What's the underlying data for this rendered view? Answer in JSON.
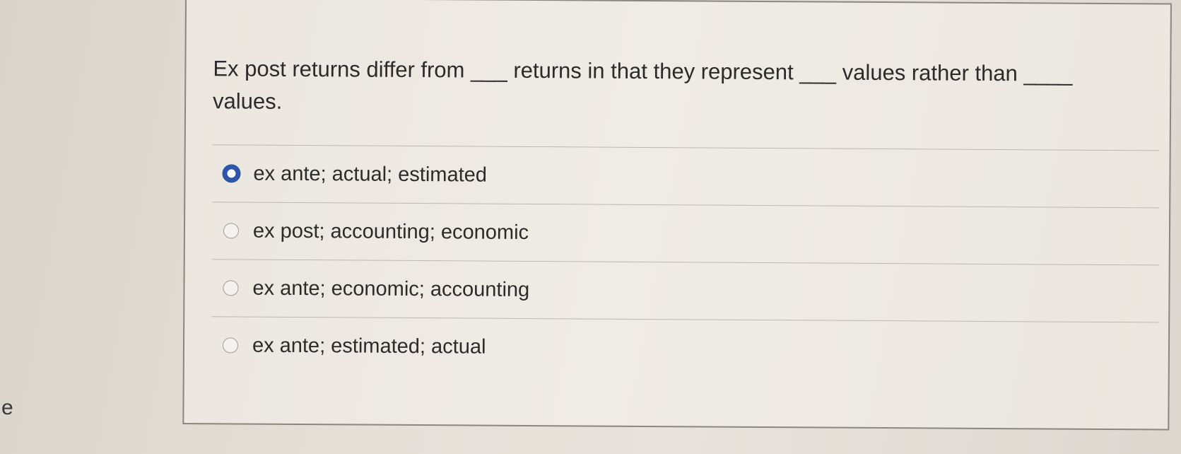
{
  "side_text": "e",
  "question": {
    "text": "Ex post returns differ from ___ returns in that they represent ___ values rather than ____ values."
  },
  "options": [
    {
      "label": "ex ante; actual; estimated",
      "selected": true
    },
    {
      "label": "ex post; accounting; economic",
      "selected": false
    },
    {
      "label": "ex ante; economic; accounting",
      "selected": false
    },
    {
      "label": "ex ante; estimated; actual",
      "selected": false
    }
  ],
  "colors": {
    "selected_radio": "#2c56a8",
    "panel_border": "#8a8780"
  }
}
